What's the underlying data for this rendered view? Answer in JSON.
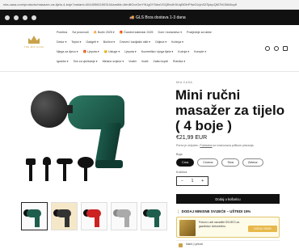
{
  "browser": {
    "url": "mia-casa.com/products/masazer-za-tijelo-4-boje?variant=40440560159310&srsltid=AfmBOorGmY9Ug0YSdwVGQBn4K9UqBDlhP9wGUyh3ZSpkpQM7MJ5A6lcy8"
  },
  "announcement": {
    "text": "🚚 GLS Brza dostava 1-3 dana",
    "social_icons": [
      "facebook-icon",
      "instagram-icon",
      "tiktok-icon",
      "whatsapp-icon"
    ]
  },
  "logo": {
    "wordmark": "THE MIA CASA"
  },
  "nav": {
    "row1": [
      "Početna",
      "Svi proizvodi",
      "🔥 Božić 2025 ▾",
      "🎁 Čarobni kalendar 2025",
      "Dom i kuhanstvo ▾",
      "Posljednje za lakše"
    ],
    "row2": [
      "Dekor ▾",
      "Tepisi ▾",
      "Gadgeti ▾",
      "Božićni ▾",
      "Dnevni i kavljaški ništi ▾",
      "Odjeća ▾",
      "Kuhinja ▾"
    ],
    "row3": [
      "Njega za djecu ▾",
      "🎁 Ljepota ▾",
      "😊 Usluge ▾",
      "Ljepota ▾",
      "Kozmetika i njega tijela ▾",
      "Kučnja ▾",
      "Kompie ▾"
    ],
    "row4": [
      "Igračke ▾",
      "Sve za vježbanje ▾",
      "Miriane svijeće ▾",
      "Vodiči",
      "Vodič",
      "Zašto kupiti",
      "Rubrika ▾"
    ]
  },
  "header_icons": [
    "search-icon",
    "account-icon",
    "cart-icon"
  ],
  "product": {
    "brand": "MIA CASA",
    "title": "Mini ručni masažer za tijelo ( 4 boje )",
    "price": "€21,99 EUR",
    "tax_note_prefix": "Porez je uključen. ",
    "tax_note_link": "Poštarina",
    "tax_note_suffix": " se izračunava prilikom plaćanja.",
    "option_label": "Boja",
    "colors": [
      "Crna",
      "Crvena",
      "Siva",
      "Zelena"
    ],
    "selected_color": "Crna",
    "quantity_label": "Količina",
    "quantity": "1",
    "qty_minus": "−",
    "qty_plus": "+",
    "add_to_cart": "Dodaj u košaricu"
  },
  "promo": {
    "title": "🕯️ DODAJ MINISNE SVIJEĆE – UŠTEDI 15%",
    "card_text": "Pokon u adi narudžbi SVIJEĆI za gazdinka i Antonečinu.",
    "card_button": "DODAJ SEAR",
    "bottom_text": "Nakit | Ljekovi"
  },
  "colors": {
    "accent": "#111111",
    "gold": "#c9a24a",
    "gun_green": "#1f5e4d"
  }
}
